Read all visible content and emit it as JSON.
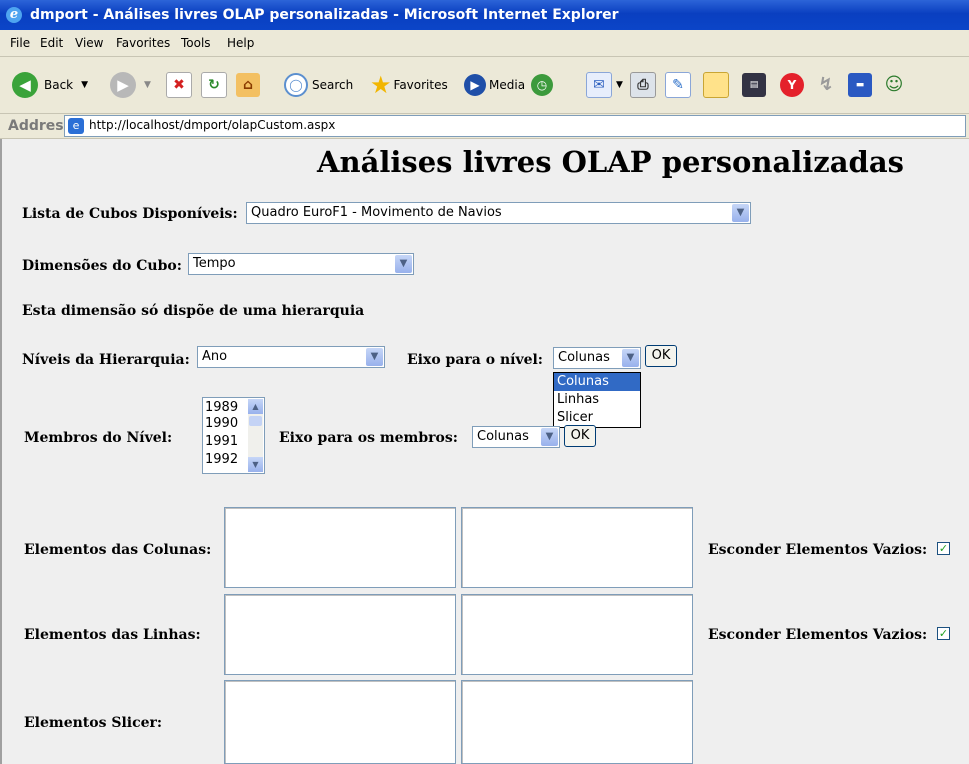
{
  "window": {
    "title": "dmport - Análises livres OLAP personalizadas - Microsoft Internet Explorer"
  },
  "menu": [
    "File",
    "Edit",
    "View",
    "Favorites",
    "Tools",
    "Help"
  ],
  "toolbar": {
    "back": "Back",
    "search": "Search",
    "favorites": "Favorites",
    "media": "Media"
  },
  "address": {
    "label": "Address",
    "url": "http://localhost/dmport/olapCustom.aspx"
  },
  "page": {
    "heading": "Análises livres OLAP personalizadas",
    "cubes": {
      "label": "Lista de Cubos Disponíveis:",
      "value": "Quadro EuroF1 - Movimento de Navios"
    },
    "dimensions": {
      "label": "Dimensões do Cubo:",
      "value": "Tempo"
    },
    "hierarchy_note": "Esta dimensão só dispõe de uma hierarquia",
    "levels": {
      "label": "Níveis da Hierarquia:",
      "value": "Ano"
    },
    "level_axis": {
      "label": "Eixo para o nível:",
      "value": "Colunas",
      "ok": "OK",
      "options": [
        "Colunas",
        "Linhas",
        "Slicer"
      ]
    },
    "members": {
      "label": "Membros do Nível:",
      "items": [
        "1989",
        "1990",
        "1991",
        "1992"
      ]
    },
    "members_axis": {
      "label": "Eixo para os membros:",
      "value": "Colunas",
      "ok": "OK"
    },
    "columns": {
      "label": "Elementos das Colunas:",
      "hide_label": "Esconder Elementos Vazios:",
      "hide_checked": true
    },
    "rows": {
      "label": "Elementos das Linhas:",
      "hide_label": "Esconder Elementos Vazios:",
      "hide_checked": true
    },
    "slicer": {
      "label": "Elementos Slicer:"
    }
  }
}
